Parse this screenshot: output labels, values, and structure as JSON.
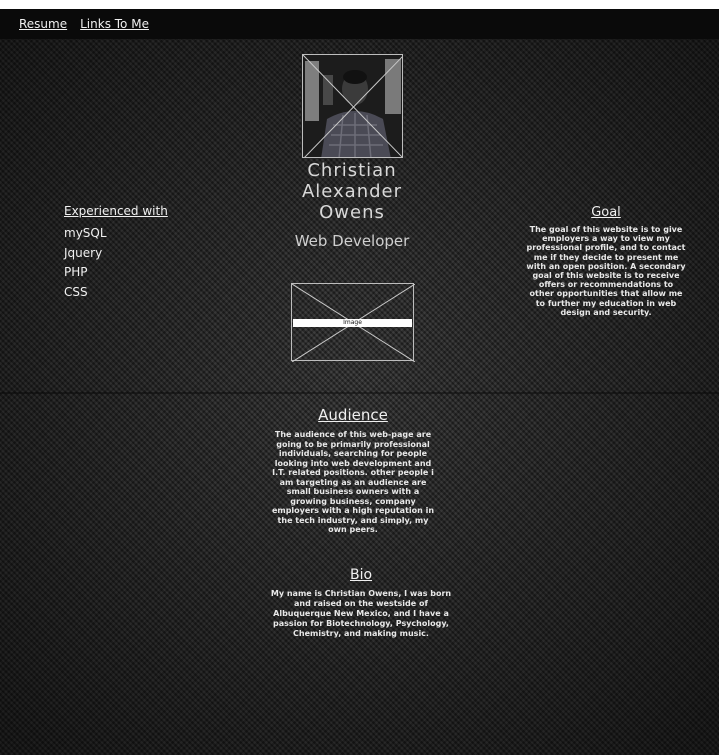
{
  "nav": {
    "links": [
      {
        "label": "Resume"
      },
      {
        "label": "Links To Me"
      }
    ]
  },
  "profile": {
    "name_lines": [
      "Christian",
      "Alexander",
      "Owens"
    ],
    "role": "Web Developer"
  },
  "placeholder_image": {
    "label": "Image"
  },
  "experience": {
    "heading": "Experienced with",
    "items": [
      "mySQL",
      "Jquery",
      "PHP",
      "CSS"
    ]
  },
  "goal": {
    "heading": "Goal",
    "text": "The goal of this website is to give employers a way to view my professional profile, and to contact me if they decide to present me with an open position. A secondary goal of this website is to receive offers or recommendations to other opportunities that allow me to further my education in web design and security."
  },
  "audience": {
    "heading": "Audience",
    "text": "The audience of this web-page are going to be primarily professional individuals, searching for people looking into web development and I.T. related positions. other people i am targeting as an audience are small business owners with a growing business, company employers with a high reputation in the tech industry, and simply, my own peers."
  },
  "bio": {
    "heading": "Bio",
    "text": "My name is Christian Owens, I was born and raised on the westside of Albuquerque New Mexico, and I have a passion for Biotechnology, Psychology, Chemistry, and making music."
  }
}
